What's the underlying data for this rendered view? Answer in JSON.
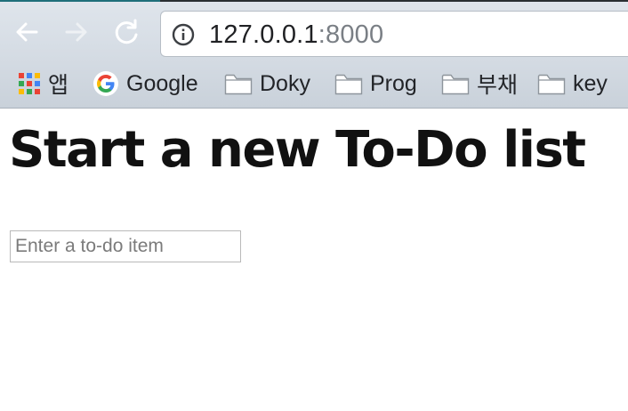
{
  "browser": {
    "address": {
      "host": "127.0.0.1",
      "port": ":8000"
    },
    "bookmarks": [
      {
        "label": "앱",
        "icon": "apps-grid-icon"
      },
      {
        "label": "Google",
        "icon": "google-icon"
      },
      {
        "label": "Doky",
        "icon": "folder-icon"
      },
      {
        "label": "Prog",
        "icon": "folder-icon"
      },
      {
        "label": "부채",
        "icon": "folder-icon"
      },
      {
        "label": "key",
        "icon": "folder-icon"
      }
    ],
    "nav_icons": [
      "back-arrow-icon",
      "forward-arrow-icon",
      "reload-icon",
      "info-icon"
    ]
  },
  "page": {
    "title": "Start a new To-Do list",
    "new_item": {
      "value": "",
      "placeholder": "Enter a to-do item"
    }
  },
  "colors": {
    "toolbar_bg": "#d4dbe3",
    "nav_icon": "#ffffff",
    "url_text": "#202124",
    "url_port": "#7a7f85",
    "google_blue": "#4285F4",
    "google_red": "#EA4335",
    "google_yellow": "#FBBC05",
    "google_green": "#34A853"
  }
}
